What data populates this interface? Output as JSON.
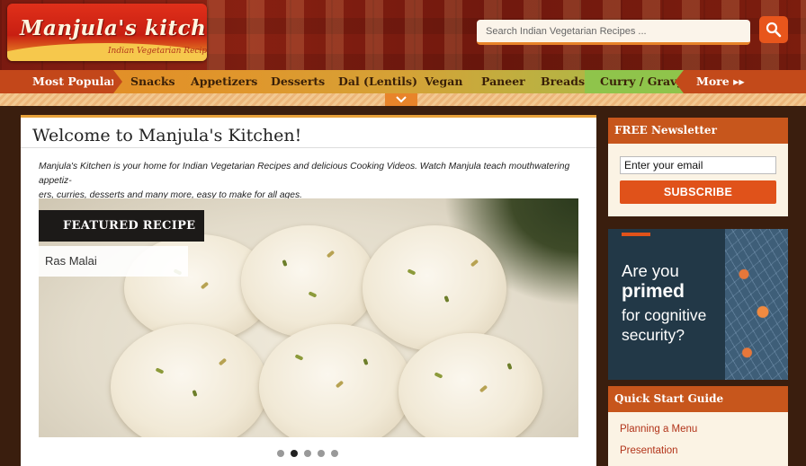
{
  "header": {
    "logo_title": "Manjula's kitchen",
    "logo_tagline": "Indian Vegetarian Recipes",
    "search_placeholder": "Search Indian Vegetarian Recipes ..."
  },
  "nav": {
    "items": [
      "Most Popular",
      "Snacks",
      "Appetizers",
      "Desserts",
      "Dal (Lentils)",
      "Vegan",
      "Paneer",
      "Breads",
      "Curry / Gravy",
      "More ▸▸"
    ]
  },
  "main": {
    "title": "Welcome to Manjula's Kitchen!",
    "intro_line1": "Manjula's Kitchen is your home for Indian Vegetarian Recipes and delicious Cooking Videos. Watch Manjula teach mouthwatering appetiz-",
    "intro_line2": "ers, curries, desserts and many more, easy to make for all ages.",
    "featured_label": "FEATURED RECIPE",
    "featured_recipe": "Ras Malai",
    "slides": 5,
    "active_slide": 2
  },
  "sidebar": {
    "newsletter": {
      "heading": "FREE Newsletter",
      "email_placeholder": "Enter your email",
      "button": "SUBSCRIBE"
    },
    "ad": {
      "line1": "Are you",
      "line2": "primed",
      "line3": "for cognitive",
      "line4": "security?"
    },
    "quick_start": {
      "heading": "Quick Start Guide",
      "links": [
        "Planning a Menu",
        "Presentation"
      ]
    }
  },
  "colors": {
    "accent_orange": "#e0521a",
    "nav_dark": "#c3471a",
    "link_red": "#b2341a"
  }
}
